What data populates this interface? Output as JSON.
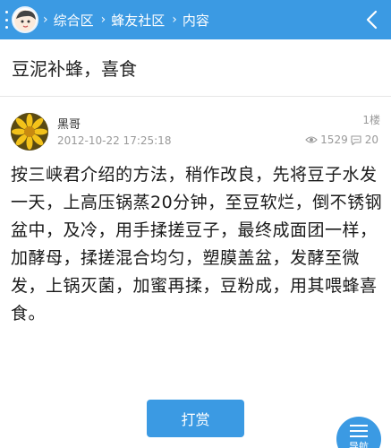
{
  "header": {
    "breadcrumbs": [
      "综合区",
      "蜂友社区",
      "内容"
    ],
    "separator": "›",
    "menu_icon": "vertical-dots-icon",
    "avatar_icon": "user-avatar-icon",
    "back_icon": "chevron-left-icon"
  },
  "post": {
    "title": "豆泥补蜂，喜食",
    "author": "黑哥",
    "time": "2012-10-22 17:25:18",
    "floor": "1楼",
    "views": "1529",
    "comments": "20",
    "content": "按三峡君介绍的方法，稍作改良，先将豆子水发一天，上高压锅蒸20分钟，至豆软烂，倒不锈钢盆中，及冷，用手揉搓豆子，最终成面团一样，加酵母，揉搓混合均匀，塑膜盖盆，发酵至微发，上锅灭菌，加蜜再揉，豆粉成，用其喂蜂喜食。"
  },
  "actions": {
    "reward_label": "打赏",
    "nav_label": "导航"
  },
  "colors": {
    "primary": "#3b9ae3",
    "text": "#1a1a1a",
    "muted": "#999999"
  }
}
